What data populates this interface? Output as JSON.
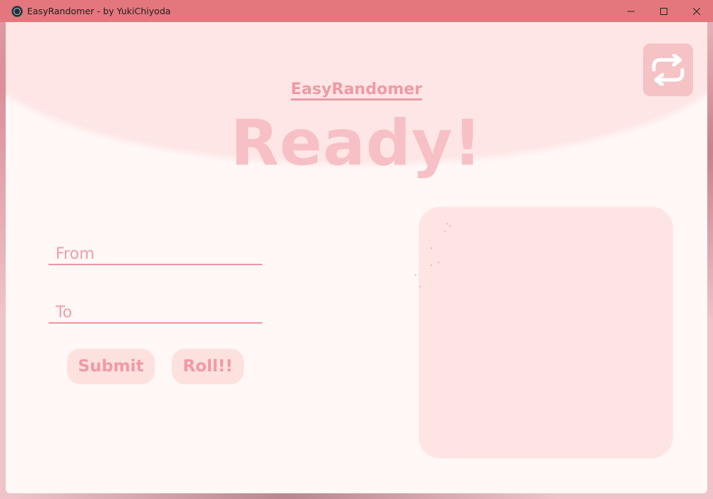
{
  "window": {
    "title": "EasyRandomer - by YukiChiyoda",
    "controls": {
      "minimize": "—",
      "maximize": "☐",
      "close": "✕"
    }
  },
  "header": {
    "brand": "EasyRandomer",
    "status": "Ready!",
    "swap_icon": "repeat-icon"
  },
  "form": {
    "from_placeholder": "From",
    "from_value": "",
    "to_placeholder": "To",
    "to_value": ""
  },
  "buttons": {
    "submit_label": "Submit",
    "roll_label": "Roll!!"
  },
  "result": {
    "value": ""
  },
  "colors": {
    "titlebar": "#e4777d",
    "accent": "#ef9aa6",
    "panel": "#fee5e4",
    "ready_text": "#f7c0c6"
  }
}
